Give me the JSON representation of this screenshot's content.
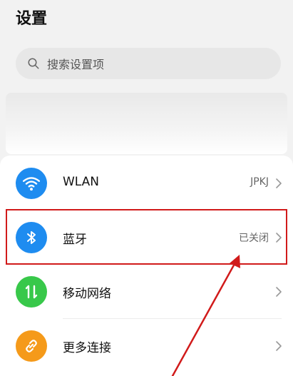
{
  "page": {
    "title": "设置"
  },
  "search": {
    "placeholder": "搜索设置项",
    "icon": "search-icon"
  },
  "list": [
    {
      "id": "wlan",
      "label": "WLAN",
      "value": "JPKJ",
      "icon": "wifi-icon",
      "color": "#1e8cf0"
    },
    {
      "id": "bluetooth",
      "label": "蓝牙",
      "value": "已关闭",
      "icon": "bluetooth-icon",
      "color": "#1e8cf0"
    },
    {
      "id": "mobile-network",
      "label": "移动网络",
      "value": "",
      "icon": "mobile-data-icon",
      "color": "#38c84a"
    },
    {
      "id": "more-connections",
      "label": "更多连接",
      "value": "",
      "icon": "link-icon",
      "color": "#f59a1a"
    }
  ],
  "annotation": {
    "highlight_color": "#d11a1a"
  }
}
